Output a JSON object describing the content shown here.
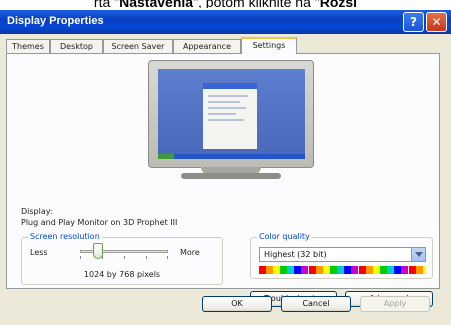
{
  "caption": {
    "prefix": "rta \"",
    "tab_word": "Nastavenia",
    "middle": "\", potom kliknite na \"",
    "target_word": "Rozsl"
  },
  "window": {
    "title": "Display Properties",
    "help_label": "?",
    "close_label": "✕"
  },
  "tabs": [
    {
      "label": "Themes"
    },
    {
      "label": "Desktop"
    },
    {
      "label": "Screen Saver"
    },
    {
      "label": "Appearance"
    },
    {
      "label": "Settings",
      "active": true
    }
  ],
  "display": {
    "label": "Display:",
    "value": "Plug and Play Monitor on 3D Prophet III"
  },
  "resolution": {
    "legend": "Screen resolution",
    "less_label": "Less",
    "more_label": "More",
    "value": "1024 by 768 pixels",
    "slider_position": 0.2
  },
  "color_quality": {
    "legend": "Color quality",
    "selected": "Highest (32 bit)"
  },
  "buttons": {
    "troubleshoot": "Troubleshoot...",
    "advanced": "Advanced",
    "ok": "OK",
    "cancel": "Cancel",
    "apply": "Apply"
  },
  "colors": {
    "titlebar": "#0a3fc3",
    "legend_text": "#0046d5",
    "active_tab_accent": "#f3c649"
  }
}
